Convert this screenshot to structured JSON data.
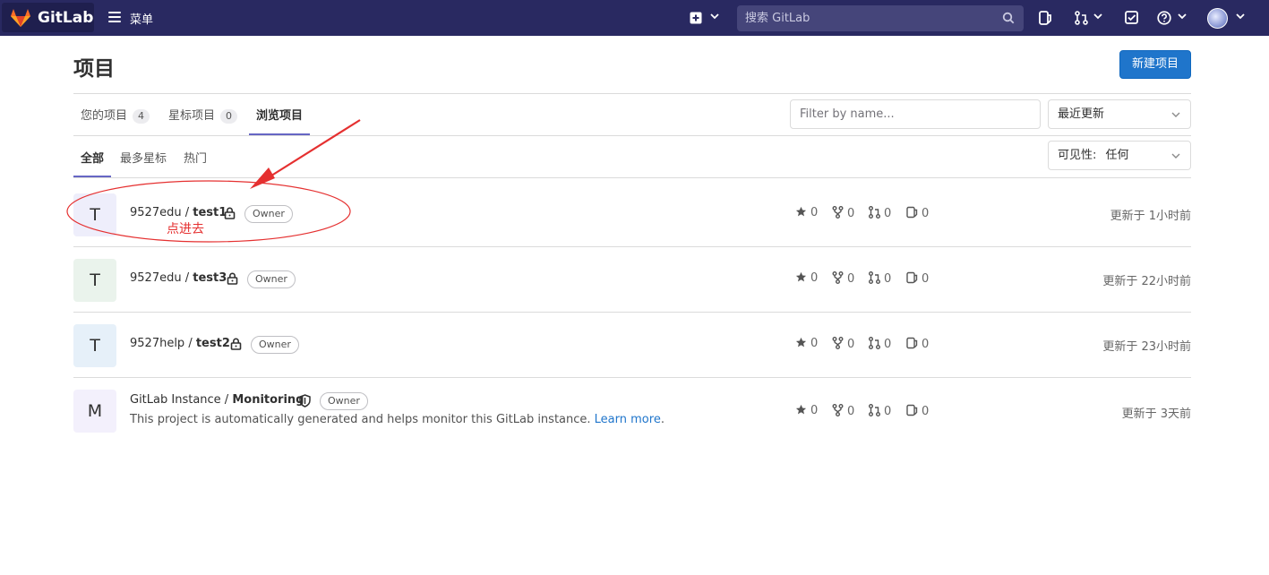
{
  "navbar": {
    "brand": "GitLab",
    "menu_label": "菜单",
    "search_placeholder": "搜索 GitLab",
    "icons": [
      "gitlab-logo-icon",
      "hamburger-icon",
      "plus-square-icon",
      "search-icon",
      "issues-icon",
      "merge-request-icon",
      "todo-icon",
      "help-icon",
      "user-avatar"
    ]
  },
  "page": {
    "title": "项目",
    "new_button": "新建项目"
  },
  "tabs": [
    {
      "label": "您的项目",
      "count": "4"
    },
    {
      "label": "星标项目",
      "count": "0"
    },
    {
      "label": "浏览项目"
    }
  ],
  "filter": {
    "placeholder": "Filter by name...",
    "sort_selected": "最近更新",
    "visibility_label": "可见性:",
    "visibility_selected": "任何"
  },
  "subtabs": [
    "全部",
    "最多星标",
    "热门"
  ],
  "projects": [
    {
      "initial": "T",
      "namespace": "9527edu",
      "name": "test1",
      "badge": "Owner",
      "stars": "0",
      "forks": "0",
      "mrs": "0",
      "issues": "0",
      "updated": "更新于 1小时前",
      "avatar_color": "#eeeefb"
    },
    {
      "initial": "T",
      "namespace": "9527edu",
      "name": "test3",
      "badge": "Owner",
      "stars": "0",
      "forks": "0",
      "mrs": "0",
      "issues": "0",
      "updated": "更新于 22小时前",
      "avatar_color": "#eaf3ec"
    },
    {
      "initial": "T",
      "namespace": "9527help",
      "name": "test2",
      "badge": "Owner",
      "stars": "0",
      "forks": "0",
      "mrs": "0",
      "issues": "0",
      "updated": "更新于 23小时前",
      "avatar_color": "#e6f0f9"
    },
    {
      "initial": "M",
      "namespace": "GitLab Instance",
      "name": "Monitoring",
      "badge": "Owner",
      "description": "This project is automatically generated and helps monitor this GitLab instance.",
      "learn_more": "Learn more",
      "stars": "0",
      "forks": "0",
      "mrs": "0",
      "issues": "0",
      "updated": "更新于 3天前",
      "avatar_color": "#f3f0fc"
    }
  ],
  "annotation": {
    "text": "点进去",
    "color": "#e53030"
  },
  "colors": {
    "navbar": "#292961",
    "primary": "#1f75cb",
    "tab_underline": "#6666c4"
  }
}
